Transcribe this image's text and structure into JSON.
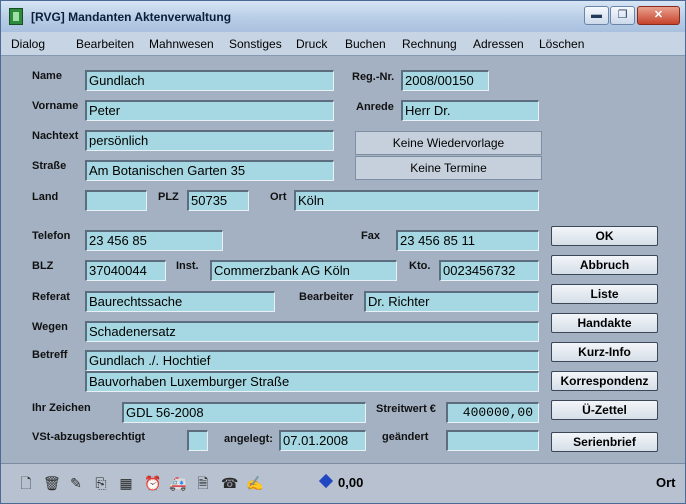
{
  "window": {
    "title": "[RVG] Mandanten Aktenverwaltung",
    "min_glyph": "▬",
    "max_glyph": "❐",
    "close_glyph": "✕"
  },
  "menu": [
    "Dialog",
    "Bearbeiten",
    "Mahnwesen",
    "Sonstiges",
    "Druck",
    "Buchen",
    "Rechnung",
    "Adressen",
    "Löschen"
  ],
  "labels": {
    "name": "Name",
    "regnr": "Reg.-Nr.",
    "vorname": "Vorname",
    "anrede": "Anrede",
    "nachtext": "Nachtext",
    "strasse": "Straße",
    "land": "Land",
    "plz": "PLZ",
    "ort": "Ort",
    "telefon": "Telefon",
    "fax": "Fax",
    "blz": "BLZ",
    "inst": "Inst.",
    "kto": "Kto.",
    "referat": "Referat",
    "bearbeiter": "Bearbeiter",
    "wegen": "Wegen",
    "betreff": "Betreff",
    "ihr_zeichen": "Ihr Zeichen",
    "streitwert": "Streitwert €",
    "vst": "VSt-abzugsberechtigt",
    "angelegt": "angelegt:",
    "geaendert": "geändert"
  },
  "fields": {
    "name": "Gundlach",
    "regnr": "2008/00150",
    "vorname": "Peter",
    "anrede": "Herr Dr.",
    "nachtext": "persönlich",
    "strasse": "Am Botanischen Garten 35",
    "land": "",
    "plz": "50735",
    "ort": "Köln",
    "telefon": "23 456 85",
    "fax": "23 456 85 11",
    "blz": "37040044",
    "inst": "Commerzbank AG Köln",
    "kto": "0023456732",
    "referat": "Baurechtssache",
    "bearbeiter": "Dr. Richter",
    "wegen": "Schadenersatz",
    "betreff1": "Gundlach ./. Hochtief",
    "betreff2": "Bauvorhaben Luxemburger Straße",
    "ihr_zeichen": "GDL 56-2008",
    "streitwert": "400000,00",
    "vst": "",
    "angelegt": "07.01.2008",
    "geaendert": ""
  },
  "info_buttons": {
    "wiedervorlage": "Keine Wiedervorlage",
    "termine": "Keine Termine"
  },
  "side_buttons": [
    "OK",
    "Abbruch",
    "Liste",
    "Handakte",
    "Kurz-Info",
    "Korrespondenz",
    "Ü-Zettel",
    "Serienbrief"
  ],
  "statusbar": {
    "toolbar_icons": [
      "new-document-icon",
      "trash-icon",
      "edit-icon",
      "copy-icon",
      "calculator-icon",
      "alarm-clock-icon",
      "ambulance-icon",
      "page-icon",
      "telephone-icon",
      "notepad-icon"
    ],
    "toolbar_glyphs": [
      "🗋",
      "🗑",
      "✎",
      "⎘",
      "▦",
      "⏰",
      "🚑",
      "🗎",
      "☎",
      "✍"
    ],
    "amount": "0,00",
    "mode": "Ort"
  }
}
